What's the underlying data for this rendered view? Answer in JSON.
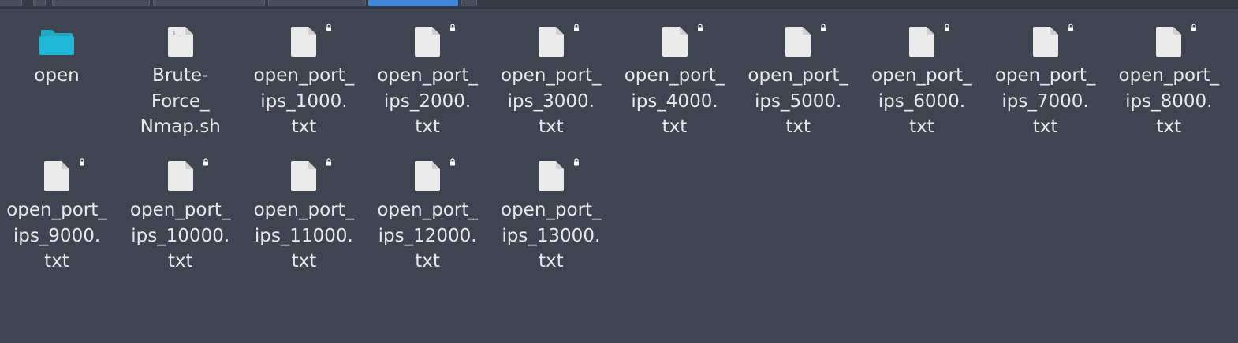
{
  "files": [
    {
      "name": "open",
      "label_lines": [
        "open"
      ],
      "type": "folder",
      "icon": "folder-icon",
      "locked": false
    },
    {
      "name": "Brute-Force_Nmap.sh",
      "label_lines": [
        "Brute-",
        "Force_",
        "Nmap.sh"
      ],
      "type": "script",
      "icon": "shell-script-icon",
      "locked": false
    },
    {
      "name": "open_port_ips_1000.txt",
      "label_lines": [
        "open_port_",
        "ips_1000.",
        "txt"
      ],
      "type": "text",
      "icon": "text-file-icon",
      "locked": true
    },
    {
      "name": "open_port_ips_2000.txt",
      "label_lines": [
        "open_port_",
        "ips_2000.",
        "txt"
      ],
      "type": "text",
      "icon": "text-file-icon",
      "locked": true
    },
    {
      "name": "open_port_ips_3000.txt",
      "label_lines": [
        "open_port_",
        "ips_3000.",
        "txt"
      ],
      "type": "text",
      "icon": "text-file-icon",
      "locked": true
    },
    {
      "name": "open_port_ips_4000.txt",
      "label_lines": [
        "open_port_",
        "ips_4000.",
        "txt"
      ],
      "type": "text",
      "icon": "text-file-icon",
      "locked": true
    },
    {
      "name": "open_port_ips_5000.txt",
      "label_lines": [
        "open_port_",
        "ips_5000.",
        "txt"
      ],
      "type": "text",
      "icon": "text-file-icon",
      "locked": true
    },
    {
      "name": "open_port_ips_6000.txt",
      "label_lines": [
        "open_port_",
        "ips_6000.",
        "txt"
      ],
      "type": "text",
      "icon": "text-file-icon",
      "locked": true
    },
    {
      "name": "open_port_ips_7000.txt",
      "label_lines": [
        "open_port_",
        "ips_7000.",
        "txt"
      ],
      "type": "text",
      "icon": "text-file-icon",
      "locked": true
    },
    {
      "name": "open_port_ips_8000.txt",
      "label_lines": [
        "open_port_",
        "ips_8000.",
        "txt"
      ],
      "type": "text",
      "icon": "text-file-icon",
      "locked": true
    },
    {
      "name": "open_port_ips_9000.txt",
      "label_lines": [
        "open_port_",
        "ips_9000.",
        "txt"
      ],
      "type": "text",
      "icon": "text-file-icon",
      "locked": true
    },
    {
      "name": "open_port_ips_10000.txt",
      "label_lines": [
        "open_port_",
        "ips_10000.",
        "txt"
      ],
      "type": "text",
      "icon": "text-file-icon",
      "locked": true
    },
    {
      "name": "open_port_ips_11000.txt",
      "label_lines": [
        "open_port_",
        "ips_11000.",
        "txt"
      ],
      "type": "text",
      "icon": "text-file-icon",
      "locked": true
    },
    {
      "name": "open_port_ips_12000.txt",
      "label_lines": [
        "open_port_",
        "ips_12000.",
        "txt"
      ],
      "type": "text",
      "icon": "text-file-icon",
      "locked": true
    },
    {
      "name": "open_port_ips_13000.txt",
      "label_lines": [
        "open_port_",
        "ips_13000.",
        "txt"
      ],
      "type": "text",
      "icon": "text-file-icon",
      "locked": true
    }
  ],
  "colors": {
    "background": "#3f4451",
    "folder": "#1fb8d6",
    "file": "#ebebeb",
    "label": "#e8e8ea",
    "active_crumb": "#3e86d6"
  }
}
